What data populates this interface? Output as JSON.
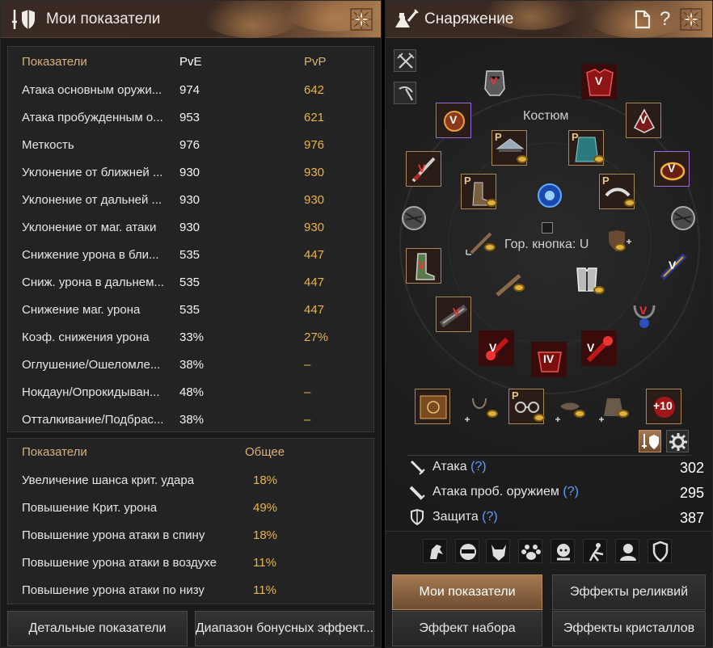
{
  "left": {
    "title": "Мои показатели",
    "table1": {
      "headers": {
        "name": "Показатели",
        "pve": "PvE",
        "pvp": "PvP"
      },
      "rows": [
        {
          "name": "Атака основным оружи...",
          "pve": "974",
          "pvp": "642"
        },
        {
          "name": "Атака пробужденным о...",
          "pve": "953",
          "pvp": "621"
        },
        {
          "name": "Меткость",
          "pve": "976",
          "pvp": "976"
        },
        {
          "name": "Уклонение от ближней ...",
          "pve": "930",
          "pvp": "930"
        },
        {
          "name": "Уклонение от дальней ...",
          "pve": "930",
          "pvp": "930"
        },
        {
          "name": "Уклонение от маг. атаки",
          "pve": "930",
          "pvp": "930"
        },
        {
          "name": "Снижение урона в бли...",
          "pve": "535",
          "pvp": "447"
        },
        {
          "name": "Сниж. урона в дальнем...",
          "pve": "535",
          "pvp": "447"
        },
        {
          "name": "Снижение маг. урона",
          "pve": "535",
          "pvp": "447"
        },
        {
          "name": "Коэф. снижения урона",
          "pve": "33%",
          "pvp": "27%"
        },
        {
          "name": "Оглушение/Ошеломле...",
          "pve": "38%",
          "pvp": "–"
        },
        {
          "name": "Нокдаун/Опрокидыван...",
          "pve": "48%",
          "pvp": "–"
        },
        {
          "name": "Отталкивание/Подбрас...",
          "pve": "38%",
          "pvp": "–"
        }
      ]
    },
    "table2": {
      "headers": {
        "name": "Показатели",
        "total": "Общее"
      },
      "rows": [
        {
          "name": "Увеличение шанса крит. удара",
          "total": "18%"
        },
        {
          "name": "Повышение Крит. урона",
          "total": "49%"
        },
        {
          "name": "Повышение урона атаки в спину",
          "total": "18%"
        },
        {
          "name": "Повышение урона атаки в воздухе",
          "total": "11%"
        },
        {
          "name": "Повышение урона атаки по низу",
          "total": "11%"
        }
      ]
    },
    "buttons": {
      "details": "Детальные показатели",
      "bonus_range": "Диапазон бонусных эффект..."
    }
  },
  "right": {
    "title": "Снаряжение",
    "help_glyph": "?",
    "costume_label": "Костюм",
    "hotkey_label": "Гор. кнопка: U",
    "slot_level_label": "V",
    "slot_level_label_iv": "IV",
    "badge_p": "P",
    "enhance_label": "+10",
    "stats": [
      {
        "label": "Атака",
        "q": "(?)",
        "value": "302"
      },
      {
        "label": "Атака проб. оружием",
        "q": "(?)",
        "value": "295"
      },
      {
        "label": "Защита",
        "q": "(?)",
        "value": "387"
      }
    ],
    "buttons": {
      "my_stats": "Мои показатели",
      "relic_effects": "Эффекты реликвий",
      "set_effect": "Эффект набора",
      "crystal_effects": "Эффекты кристаллов"
    }
  },
  "colors": {
    "accent_gold": "#e9b44a",
    "header_gold": "#d9b27a",
    "active_button": "#8a6342",
    "frame_gold": "#a7865a",
    "frame_purple": "#9a6ad6",
    "link_blue": "#5aa0ff"
  },
  "icons": [
    "stats-shield-icon",
    "flower-ornament-icon",
    "equipment-potion-icon",
    "document-icon",
    "help-icon",
    "crossed-swords-icon",
    "pickaxe-icon",
    "sword-icon",
    "shield-icon",
    "gear-icon",
    "coin-icon"
  ]
}
